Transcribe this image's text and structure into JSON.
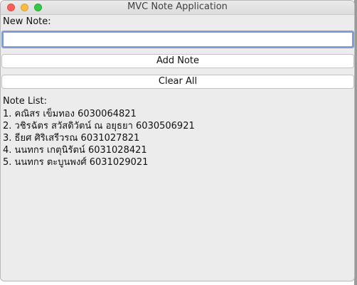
{
  "window": {
    "title": "MVC Note Application"
  },
  "form": {
    "new_note_label": "New Note:",
    "input_value": "",
    "input_placeholder": "",
    "add_button_label": "Add Note",
    "clear_button_label": "Clear All"
  },
  "list": {
    "label": "Note List:",
    "items": [
      "1. คณิสร เข็มทอง 6030064821",
      "2. วชิรฉัตร สวัสดิวัตน์ ณ อยุธยา 6030506921",
      "3. ธียศ ศิริเสรีวรณ 6031027821",
      "4. นนทกร เกตุนิรัตน์ 6031028421",
      "5. นนทกร ตะบูนพงศ์ 6031029021"
    ]
  },
  "colors": {
    "close": "#fc605c",
    "minimize": "#fdbc40",
    "zoom": "#34c84a",
    "focus_ring": "#7d9fd6"
  },
  "icons": {
    "close": "close-icon",
    "minimize": "minimize-icon",
    "zoom": "zoom-icon"
  }
}
